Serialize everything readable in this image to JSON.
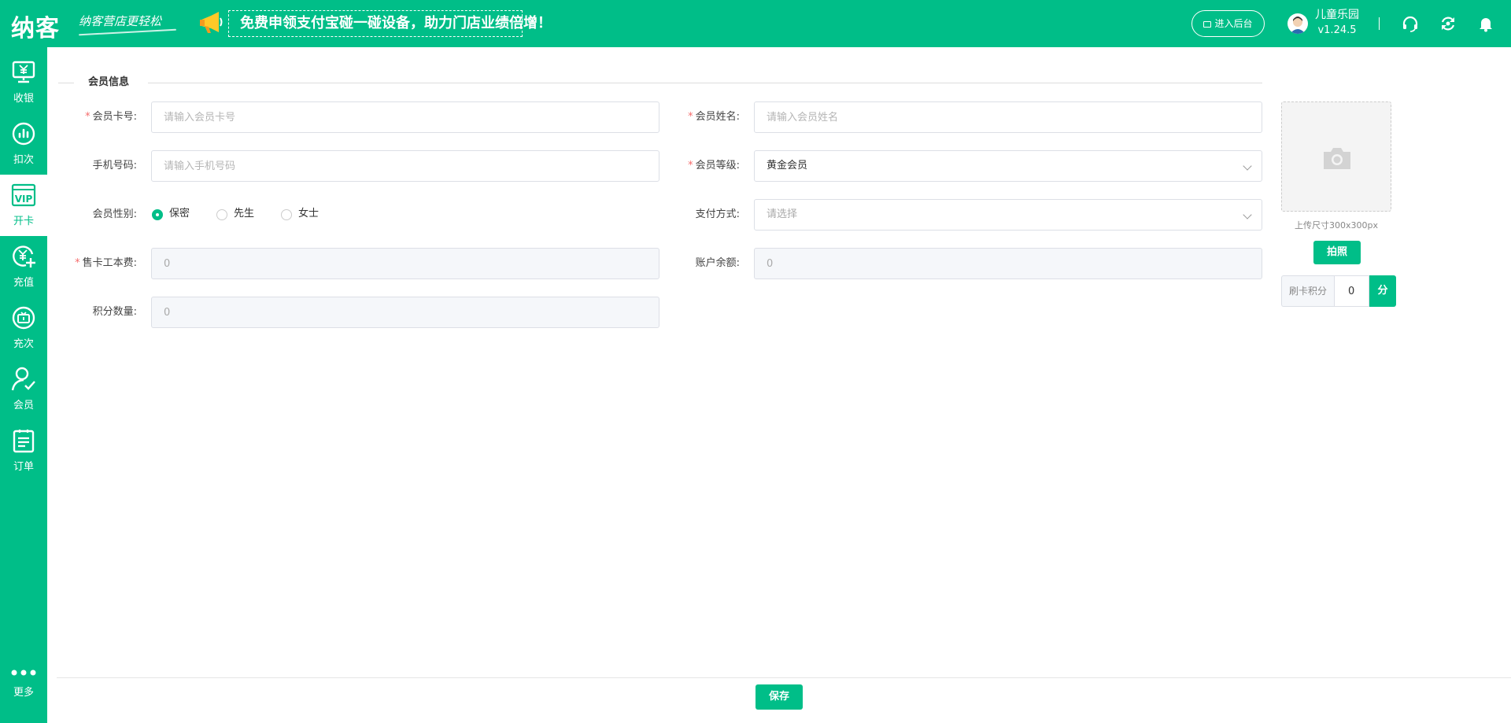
{
  "header": {
    "logo": "纳客",
    "slogan": "纳客营店更轻松",
    "promo": "免费申领支付宝碰一碰设备，助力门店业绩倍增！",
    "backend_button": "进入后台",
    "user_name": "儿童乐园",
    "version": "v1.24.5",
    "icons": [
      "headset-icon",
      "sync-icon",
      "bell-icon"
    ]
  },
  "sidebar": {
    "items": [
      {
        "label": "收银",
        "icon": "cashier-icon"
      },
      {
        "label": "扣次",
        "icon": "deduct-icon"
      },
      {
        "label": "开卡",
        "icon": "vip-card-icon",
        "active": true
      },
      {
        "label": "充值",
        "icon": "recharge-icon"
      },
      {
        "label": "充次",
        "icon": "recharge-times-icon"
      },
      {
        "label": "会员",
        "icon": "member-icon"
      },
      {
        "label": "订单",
        "icon": "order-icon"
      }
    ],
    "more_label": "更多"
  },
  "section": {
    "title": "会员信息"
  },
  "form": {
    "card_no": {
      "label": "会员卡号:",
      "placeholder": "请输入会员卡号",
      "value": ""
    },
    "name": {
      "label": "会员姓名:",
      "placeholder": "请输入会员姓名",
      "value": ""
    },
    "phone": {
      "label": "手机号码:",
      "placeholder": "请输入手机号码",
      "value": ""
    },
    "level": {
      "label": "会员等级:",
      "value": "黄金会员"
    },
    "gender": {
      "label": "会员性别:",
      "options": [
        "保密",
        "先生",
        "女士"
      ],
      "selected": "保密"
    },
    "payment": {
      "label": "支付方式:",
      "placeholder": "请选择"
    },
    "card_fee": {
      "label": "售卡工本费:",
      "value": "0"
    },
    "balance": {
      "label": "账户余额:",
      "value": "0"
    },
    "points": {
      "label": "积分数量:",
      "value": "0"
    }
  },
  "photo": {
    "upload_hint": "上传尺寸300x300px",
    "shoot_button": "拍照",
    "swipe_points_label": "刷卡积分",
    "swipe_points_value": "0",
    "swipe_points_unit": "分"
  },
  "footer": {
    "save_button": "保存"
  },
  "colors": {
    "accent": "#00BE88",
    "required": "#f56c6c"
  }
}
